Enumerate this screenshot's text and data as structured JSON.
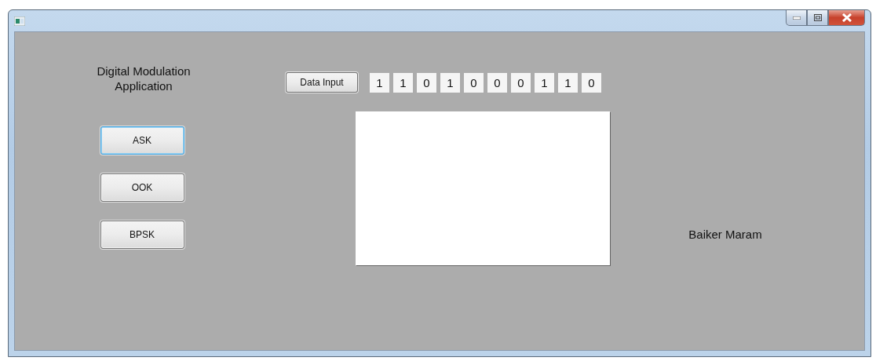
{
  "app_title": "Digital Modulation Application",
  "modulation_buttons": [
    {
      "label": "ASK",
      "focused": true
    },
    {
      "label": "OOK",
      "focused": false
    },
    {
      "label": "BPSK",
      "focused": false
    }
  ],
  "data_input_button": "Data Input",
  "bits": [
    "1",
    "1",
    "0",
    "1",
    "0",
    "0",
    "0",
    "1",
    "1",
    "0"
  ],
  "author": "Baiker Maram"
}
